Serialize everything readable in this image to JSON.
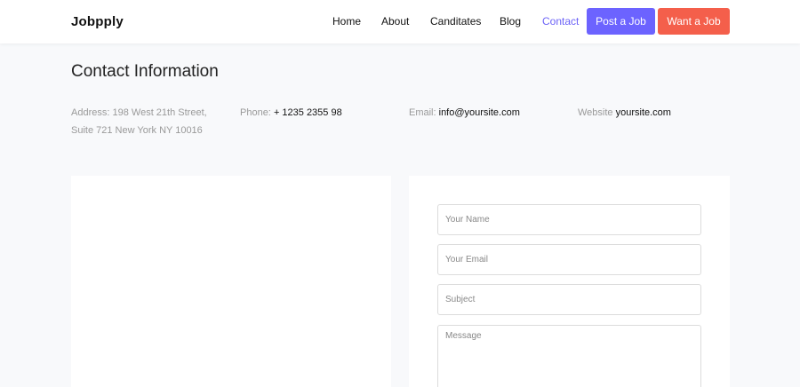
{
  "nav": {
    "brand": "Jobpply",
    "links": [
      {
        "label": "Home"
      },
      {
        "label": "About"
      },
      {
        "label": "Canditates"
      },
      {
        "label": "Blog"
      },
      {
        "label": "Contact"
      }
    ],
    "active_link": "Contact",
    "post_job_label": "Post a Job",
    "want_job_label": "Want a Job"
  },
  "contact": {
    "title": "Contact Information",
    "address_label": "Address:",
    "address_line1": "198 West 21th Street,",
    "address_line2": "Suite 721 New York NY 10016",
    "phone_label": "Phone:",
    "phone_value": "+ 1235 2355 98",
    "email_label": "Email:",
    "email_value": "info@yoursite.com",
    "website_label": "Website",
    "website_value": "yoursite.com"
  },
  "form": {
    "name_placeholder": "Your Name",
    "email_placeholder": "Your Email",
    "subject_placeholder": "Subject",
    "message_placeholder": "Message"
  },
  "colors": {
    "accent_purple": "#6c63ff",
    "accent_red": "#f45f4b",
    "page_background": "#f8f9fb"
  }
}
